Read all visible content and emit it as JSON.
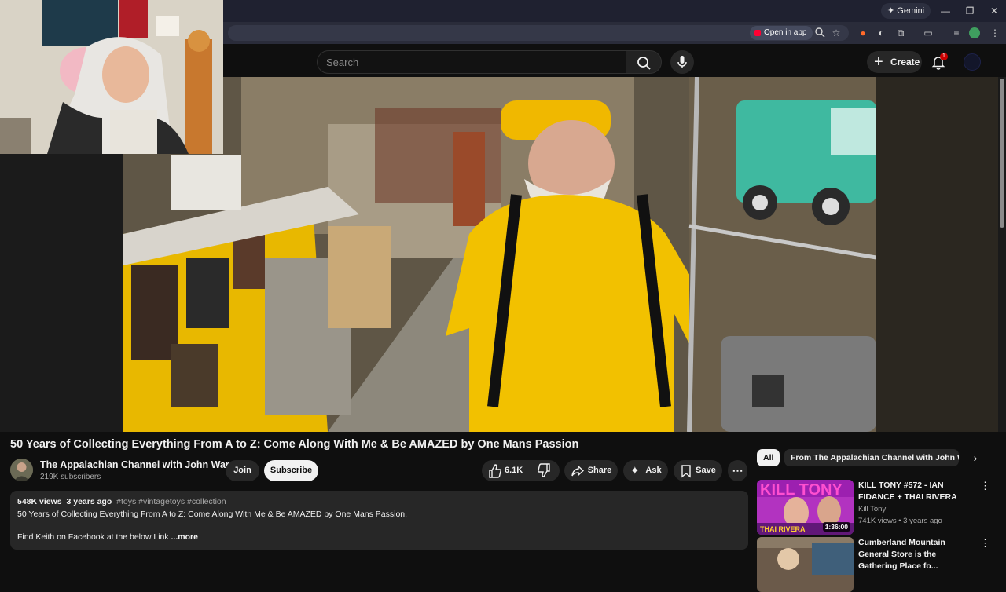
{
  "browser": {
    "gemini_label": "Gemini",
    "open_in_app_label": "Open in app",
    "window_controls": {
      "minimize": "—",
      "restore": "❐",
      "close": "✕"
    }
  },
  "header": {
    "search_placeholder": "Search",
    "create_label": "Create",
    "notification_count": "1"
  },
  "video": {
    "title": "50 Years of Collecting Everything From A to Z: Come Along With Me & Be AMAZED by One Mans Passion"
  },
  "channel": {
    "name": "The Appalachian Channel with John Ward",
    "subscribers": "219K subscribers",
    "join_label": "Join",
    "subscribe_label": "Subscribe"
  },
  "actions": {
    "likes": "6.1K",
    "share_label": "Share",
    "ask_label": "Ask",
    "save_label": "Save"
  },
  "description": {
    "views": "548K views",
    "age": "3 years ago",
    "tags": "#toys #vintagetoys #collection",
    "line1": "50 Years of Collecting Everything From A to Z:  Come Along With Me & Be AMAZED by One Mans Passion.",
    "line2": "Find Keith on Facebook at the below Link",
    "more_label": "...more"
  },
  "sidebar": {
    "chips": [
      "All",
      "From The Appalachian Channel with John Ward"
    ],
    "recommendations": [
      {
        "title": "KILL TONY #572 - IAN FIDANCE + THAI RIVERA",
        "channel": "Kill Tony",
        "stats": "741K views • 3 years ago",
        "duration": "1:36:00",
        "thumb_text_top": "KILL TONY",
        "thumb_text_bottom": "THAI RIVERA"
      },
      {
        "title": "Cumberland Mountain General Store is the Gathering Place fo...",
        "channel": "",
        "stats": "",
        "duration": ""
      }
    ]
  },
  "colors": {
    "background": "#0f0f0f",
    "accent_red": "#ff0033",
    "shirt_yellow": "#f2c100"
  }
}
